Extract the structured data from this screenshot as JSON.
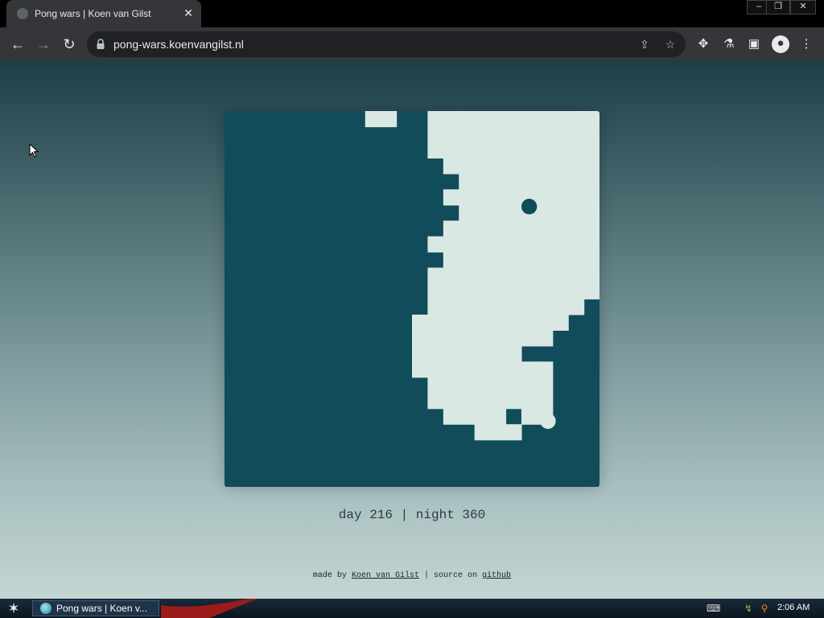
{
  "browser": {
    "tab_title": "Pong wars | Koen van Gilst",
    "tab_close": "✕",
    "url": "pong-wars.koenvangilst.nl",
    "window_controls": [
      "–",
      "❐",
      "✕"
    ]
  },
  "game": {
    "colors": {
      "day": "#d9e8e3",
      "night": "#114c5a"
    },
    "grid": {
      "cols": 24,
      "rows": 24,
      "day_map": [
        "000000000110011111111111",
        "000000000000011111111111",
        "000000000000011111111111",
        "000000000000001111111111",
        "000000000000000111111111",
        "000000000000001111111111",
        "000000000000000111111111",
        "000000000000001111111111",
        "000000000000011111111111",
        "000000000000001111111111",
        "000000000000011111111111",
        "000000000000011111111111",
        "000000000000011111111110",
        "000000000000111111111100",
        "000000000000111111111000",
        "000000000000111111100000",
        "000000000000111111111000",
        "000000000000011111111000",
        "000000000000011111111000",
        "000000000000001111011000",
        "000000000000000011100000",
        "000000000000000000000000",
        "000000000000000000000000",
        "000000000000000000000000"
      ]
    },
    "balls": [
      {
        "team": "night",
        "col": 19.5,
        "row": 6.1
      },
      {
        "team": "day",
        "col": 20.7,
        "row": 19.8
      }
    ]
  },
  "score": {
    "text": "day 216 | night 360"
  },
  "credits": {
    "prefix": "made by",
    "author": "Koen van Gilst",
    "separator": "|",
    "source_prefix": "source on",
    "source_link": "github"
  },
  "taskbar": {
    "start_icon": "star-icon",
    "task_label": "Pong wars | Koen v...",
    "clock": "2:06 AM"
  }
}
